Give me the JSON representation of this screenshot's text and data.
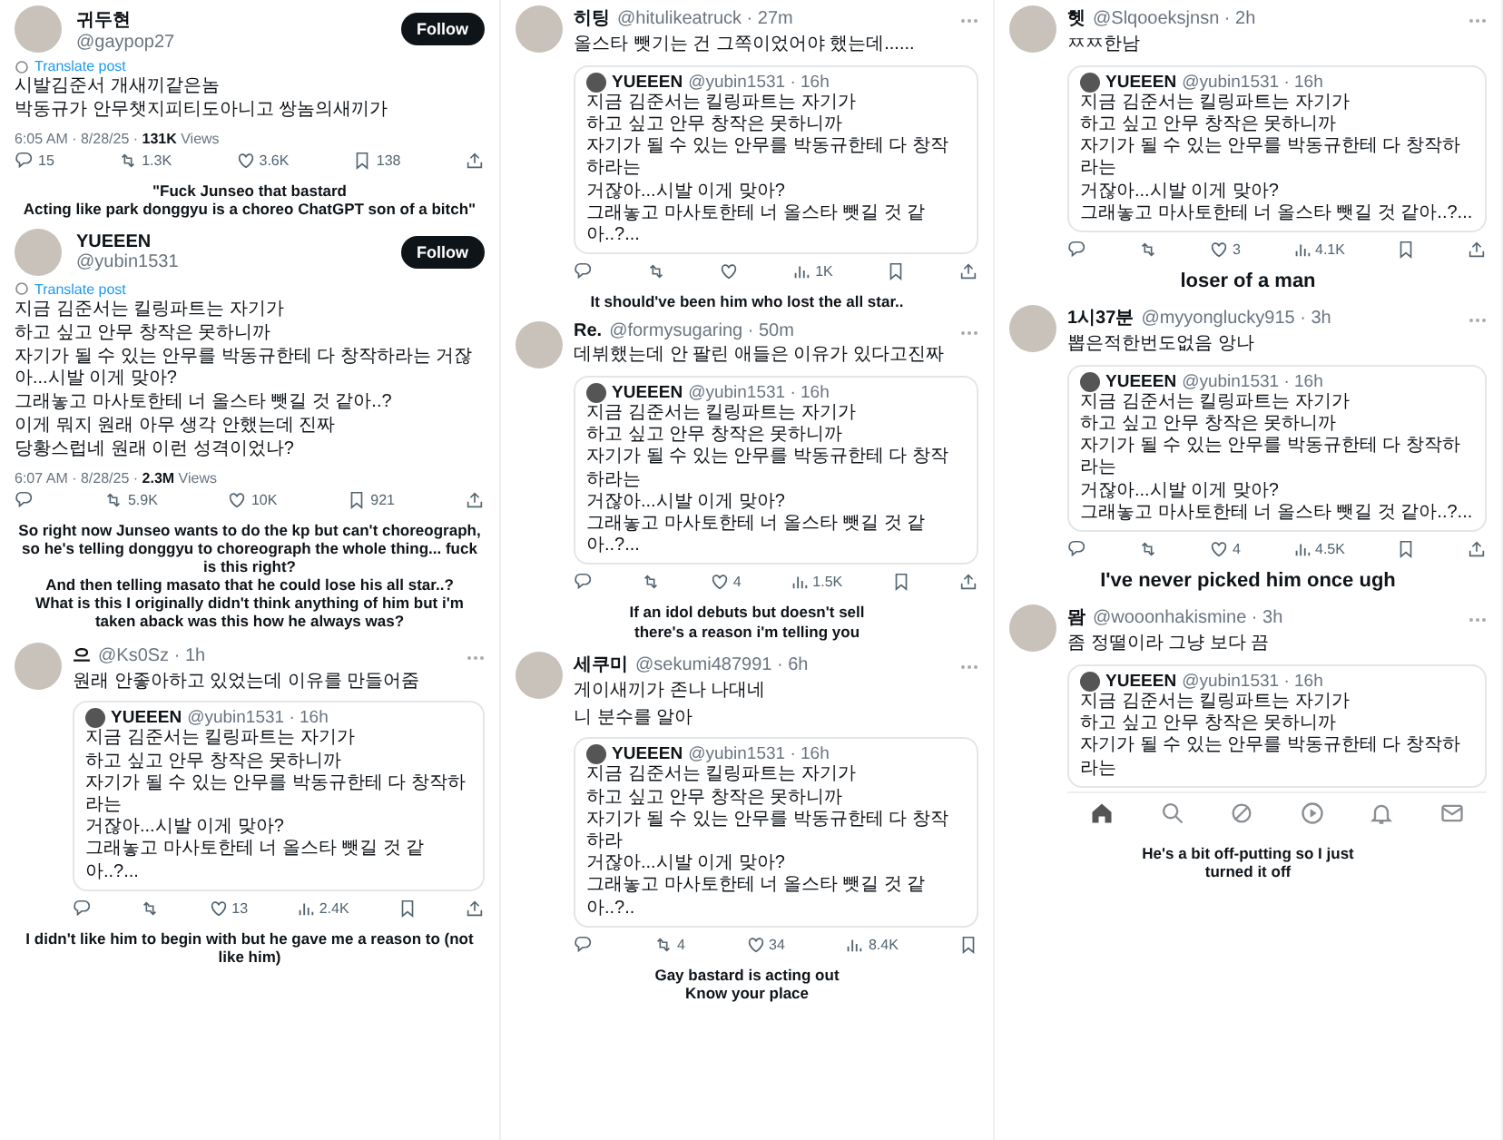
{
  "columns": [
    {
      "items": [
        {
          "kind": "post",
          "name": "귀두현",
          "handle": "@gaypop27",
          "follow": "Follow",
          "translate": "Translate post",
          "lines": [
            "시발김준서 개새끼같은놈",
            "박동규가 안무챗지피티도아니고 쌍놈의새끼가"
          ],
          "meta": "6:05 AM · 8/28/25 · **131K** Views",
          "actions": [
            {
              "kind": "reply",
              "count": "15"
            },
            {
              "kind": "repost",
              "count": "1.3K"
            },
            {
              "kind": "like",
              "count": "3.6K"
            },
            {
              "kind": "bookmark",
              "count": "138"
            },
            {
              "kind": "share"
            }
          ]
        },
        {
          "kind": "caption",
          "text": "\"Fuck Junseo that bastard\nActing like park donggyu is a choreo ChatGPT son of a bitch\""
        },
        {
          "kind": "post",
          "name": "YUEEEN",
          "handle": "@yubin1531",
          "follow": "Follow",
          "translate": "Translate post",
          "lines": [
            "지금 김준서는 킬링파트는 자기가",
            "하고 싶고 안무 창작은 못하니까",
            "자기가 될 수 있는 안무를 박동규한테 다 창작하라는 거잖",
            "아...시발 이게 맞아?",
            "그래놓고 마사토한테 너 올스타 뺏길 것 같아..?",
            "이게 뭐지 원래 아무 생각 안했는데 진짜",
            "당황스럽네 원래 이런 성격이었나?"
          ],
          "meta": "6:07 AM · 8/28/25 · **2.3M** Views",
          "actions": [
            {
              "kind": "reply"
            },
            {
              "kind": "repost",
              "count": "5.9K"
            },
            {
              "kind": "like",
              "count": "10K"
            },
            {
              "kind": "bookmark",
              "count": "921"
            },
            {
              "kind": "share"
            }
          ]
        },
        {
          "kind": "caption",
          "text": "So right now Junseo wants to do the kp but can't choreograph, so he's telling donggyu to choreograph the whole thing... fuck is this right?\nAnd then telling masato that he could lose his all star..?\nWhat is this I originally didn't think anything of him but i'm taken aback was this how he always was?"
        },
        {
          "kind": "reply",
          "name": "으",
          "handle": "@Ks0Sz · 1h",
          "lines": [
            "원래 안좋아하고 있었는데 이유를 만들어줌"
          ],
          "quote": {
            "name": "YUEEEN",
            "handle": "@yubin1531 · 16h",
            "lines": [
              "지금 김준서는 킬링파트는 자기가",
              "하고 싶고 안무 창작은 못하니까",
              "자기가 될 수 있는 안무를 박동규한테 다 창작하라는",
              "거잖아...시발 이게 맞아?",
              "그래놓고 마사토한테 너 올스타 뺏길 것 같아..?..."
            ]
          },
          "actions": [
            {
              "kind": "reply"
            },
            {
              "kind": "repost"
            },
            {
              "kind": "like",
              "count": "13"
            },
            {
              "kind": "views",
              "count": "2.4K"
            },
            {
              "kind": "bookmark"
            },
            {
              "kind": "share"
            }
          ]
        },
        {
          "kind": "caption",
          "text": "I didn't like him to begin with but he gave me a reason to (not like him)"
        }
      ]
    },
    {
      "items": [
        {
          "kind": "reply",
          "name": "히팅",
          "handle": "@hitulikeatruck · 27m",
          "lines": [
            "올스타 뺏기는 건 그쪽이었어야 했는데......"
          ],
          "quote": {
            "name": "YUEEEN",
            "handle": "@yubin1531 · 16h",
            "lines": [
              "지금 김준서는 킬링파트는 자기가",
              "하고 싶고 안무 창작은 못하니까",
              "자기가 될 수 있는 안무를 박동규한테 다 창작하라는",
              "거잖아...시발 이게 맞아?",
              "그래놓고 마사토한테 너 올스타 뺏길 것 같아..?..."
            ]
          },
          "actions": [
            {
              "kind": "reply"
            },
            {
              "kind": "repost"
            },
            {
              "kind": "like"
            },
            {
              "kind": "views",
              "count": "1K"
            },
            {
              "kind": "bookmark"
            },
            {
              "kind": "share"
            }
          ]
        },
        {
          "kind": "caption",
          "text": "It should've been him who lost the all star.."
        },
        {
          "kind": "reply",
          "name": "Re.",
          "handle": "@formysugaring · 50m",
          "lines": [
            "데뷔했는데 안 팔린 애들은 이유가 있다고진짜"
          ],
          "quote": {
            "name": "YUEEEN",
            "handle": "@yubin1531 · 16h",
            "lines": [
              "지금 김준서는 킬링파트는 자기가",
              "하고 싶고 안무 창작은 못하니까",
              "자기가 될 수 있는 안무를 박동규한테 다 창작하라는",
              "거잖아...시발 이게 맞아?",
              "그래놓고 마사토한테 너 올스타 뺏길 것 같아..?..."
            ]
          },
          "actions": [
            {
              "kind": "reply"
            },
            {
              "kind": "repost"
            },
            {
              "kind": "like",
              "count": "4"
            },
            {
              "kind": "views",
              "count": "1.5K"
            },
            {
              "kind": "bookmark"
            },
            {
              "kind": "share"
            }
          ]
        },
        {
          "kind": "caption",
          "text": "If an idol debuts but doesn't sell\nthere's a reason i'm telling you"
        },
        {
          "kind": "reply",
          "name": "세쿠미",
          "handle": "@sekumi487991 · 6h",
          "lines": [
            "게이새끼가 존나 나대네",
            "니 분수를 알아"
          ],
          "quote": {
            "name": "YUEEEN",
            "handle": "@yubin1531 · 16h",
            "lines": [
              "지금 김준서는 킬링파트는 자기가",
              "하고 싶고 안무 창작은 못하니까",
              "자기가 될 수 있는 안무를 박동규한테 다 창작하라",
              "거잖아...시발 이게 맞아?",
              "그래놓고 마사토한테 너 올스타 뺏길 것 같아..?.."
            ]
          },
          "actions": [
            {
              "kind": "reply"
            },
            {
              "kind": "repost",
              "count": "4"
            },
            {
              "kind": "like",
              "count": "34"
            },
            {
              "kind": "views",
              "count": "8.4K"
            },
            {
              "kind": "bookmark"
            }
          ]
        },
        {
          "kind": "caption",
          "text": "Gay bastard is acting out\nKnow your place"
        }
      ]
    },
    {
      "items": [
        {
          "kind": "reply",
          "name": "헷",
          "handle": "@Slqooeksjnsn · 2h",
          "lines": [
            "ㅉㅉ한남"
          ],
          "quote": {
            "name": "YUEEEN",
            "handle": "@yubin1531 · 16h",
            "lines": [
              "지금 김준서는 킬링파트는 자기가",
              "하고 싶고 안무 창작은 못하니까",
              "자기가 될 수 있는 안무를 박동규한테 다 창작하라는",
              "거잖아...시발 이게 맞아?",
              "그래놓고 마사토한테 너 올스타 뺏길 것 같아..?..."
            ]
          },
          "actions": [
            {
              "kind": "reply"
            },
            {
              "kind": "repost"
            },
            {
              "kind": "like",
              "count": "3"
            },
            {
              "kind": "views",
              "count": "4.1K"
            },
            {
              "kind": "bookmark"
            },
            {
              "kind": "share"
            }
          ]
        },
        {
          "kind": "caption",
          "text": "loser of a man"
        },
        {
          "kind": "reply",
          "name": "1시37분",
          "handle": "@myyonglucky915 · 3h",
          "lines": [
            "뽑은적한번도없음 앙나"
          ],
          "quote": {
            "name": "YUEEEN",
            "handle": "@yubin1531 · 16h",
            "lines": [
              "지금 김준서는 킬링파트는 자기가",
              "하고 싶고 안무 창작은 못하니까",
              "자기가 될 수 있는 안무를 박동규한테 다 창작하라는",
              "거잖아...시발 이게 맞아?",
              "그래놓고 마사토한테 너 올스타 뺏길 것 같아..?..."
            ]
          },
          "actions": [
            {
              "kind": "reply"
            },
            {
              "kind": "repost"
            },
            {
              "kind": "like",
              "count": "4"
            },
            {
              "kind": "views",
              "count": "4.5K"
            },
            {
              "kind": "bookmark"
            },
            {
              "kind": "share"
            }
          ]
        },
        {
          "kind": "caption",
          "text": "I've never picked him once ugh"
        },
        {
          "kind": "reply",
          "name": "뫔",
          "handle": "@wooonhakismine · 3h",
          "lines": [
            "좀 정떨이라 그냥 보다 끔"
          ],
          "quote": {
            "name": "YUEEEN",
            "handle": "@yubin1531 · 16h",
            "lines": [
              "지금 김준서는 킬링파트는 자기가",
              "하고 싶고 안무 창작은 못하니까",
              "자기가 될 수 있는 안무를 박동규한테 다 창작하라는"
            ]
          },
          "nav_bar": [
            {
              "kind": "home",
              "selected": true
            },
            {
              "kind": "search",
              "selected": false
            },
            {
              "kind": "grok",
              "selected": false
            },
            {
              "kind": "play",
              "selected": false
            },
            {
              "kind": "bell",
              "selected": false
            },
            {
              "kind": "mail",
              "selected": false
            }
          ]
        },
        {
          "kind": "caption",
          "text": "He's a bit off-putting so I just\nturned it off"
        }
      ]
    }
  ]
}
